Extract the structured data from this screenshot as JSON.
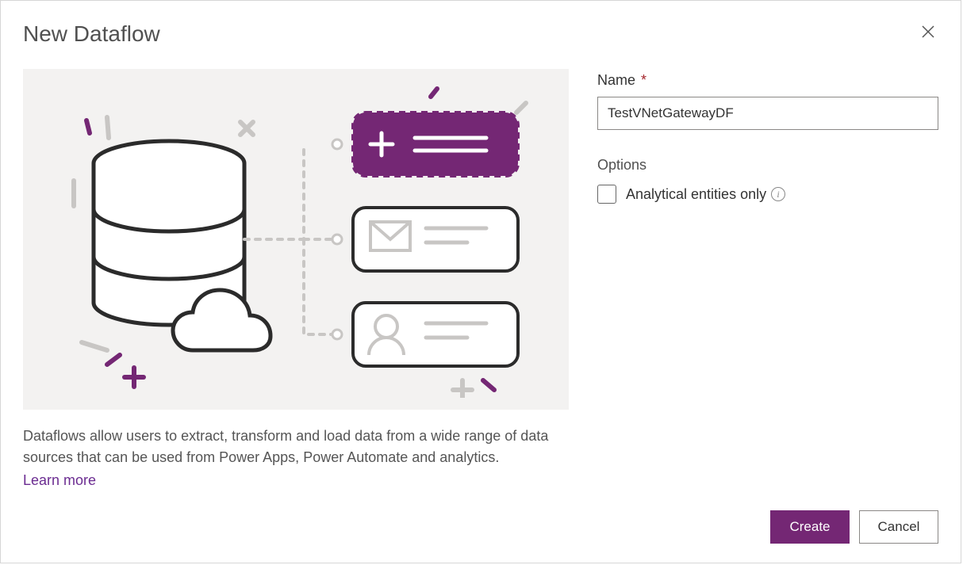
{
  "dialog": {
    "title": "New Dataflow",
    "description": "Dataflows allow users to extract, transform and load data from a wide range of data sources that can be used from Power Apps, Power Automate and analytics.",
    "learnMore": "Learn more"
  },
  "form": {
    "nameLabel": "Name",
    "nameValue": "TestVNetGatewayDF",
    "optionsLabel": "Options",
    "checkboxLabel": "Analytical entities only"
  },
  "footer": {
    "create": "Create",
    "cancel": "Cancel"
  },
  "colors": {
    "accent": "#742774"
  }
}
